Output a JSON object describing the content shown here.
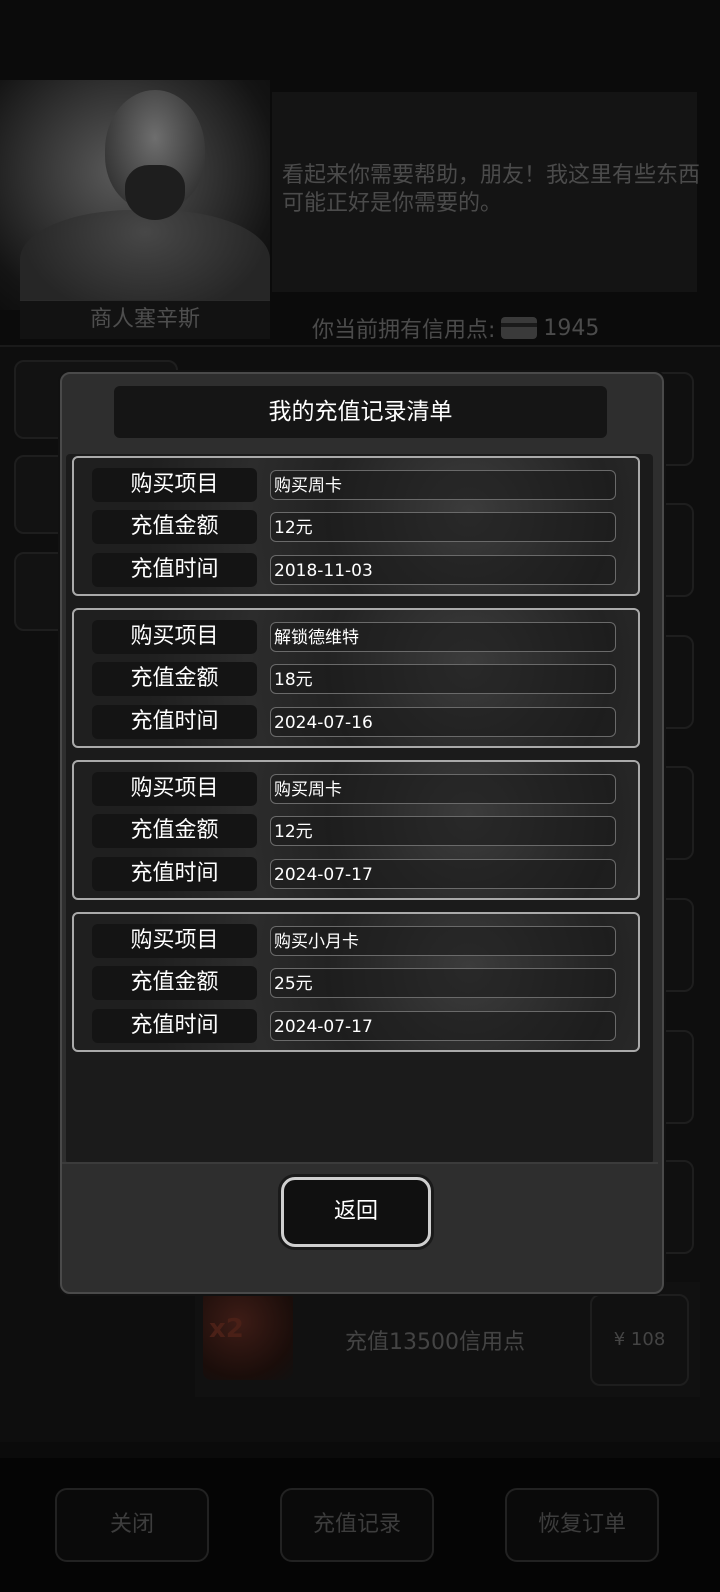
{
  "merchant": {
    "name": "商人塞辛斯",
    "speech": "看起来你需要帮助，朋友！我这里有些东西可能正好是你需要的。",
    "credits_label": "你当前拥有信用点:",
    "credits_value": "1945",
    "credits_icon": "credit-card-icon"
  },
  "shop": {
    "visible_item": {
      "multiplier": "x2",
      "label": "充值13500信用点",
      "price": "¥ 108"
    }
  },
  "bottom_bar": {
    "close_label": "关闭",
    "history_label": "充值记录",
    "restore_label": "恢复订单"
  },
  "modal": {
    "title": "我的充值记录清单",
    "field_labels": {
      "item": "购买项目",
      "amount": "充值金额",
      "time": "充值时间"
    },
    "records": [
      {
        "item": "购买周卡",
        "amount": "12元",
        "time": "2018-11-03"
      },
      {
        "item": "解锁德维特",
        "amount": "18元",
        "time": "2024-07-16"
      },
      {
        "item": "购买周卡",
        "amount": "12元",
        "time": "2024-07-17"
      },
      {
        "item": "购买小月卡",
        "amount": "25元",
        "time": "2024-07-17"
      }
    ],
    "back_label": "返回"
  },
  "colors": {
    "modal_bg": "#2e2e2e",
    "card_border": "#aaaaaa",
    "label_bg": "#141414"
  }
}
